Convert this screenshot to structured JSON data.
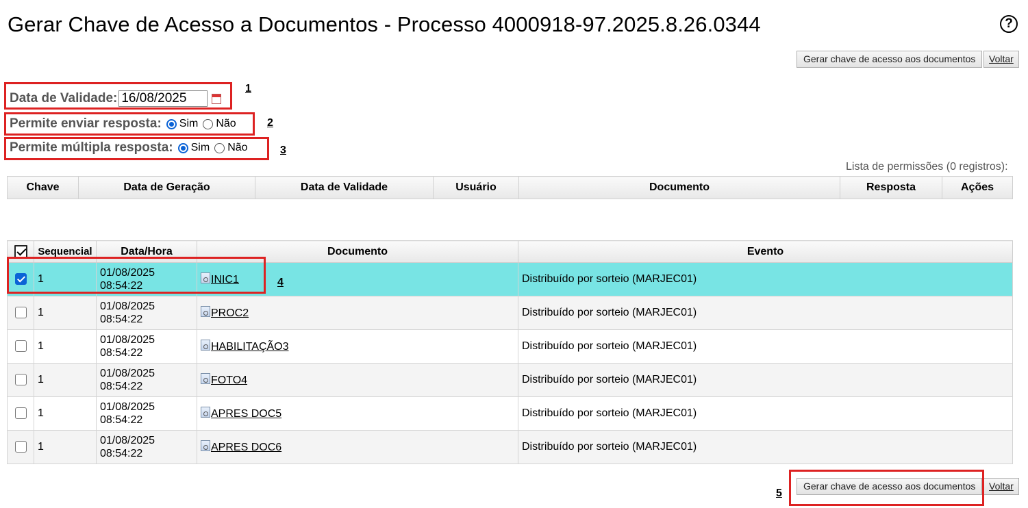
{
  "header": {
    "title": "Gerar Chave de Acesso a Documentos - Processo 4000918-97.2025.8.26.0344",
    "help_icon": "help-circle-icon"
  },
  "toolbar": {
    "generate_label": "Gerar chave de acesso aos documentos",
    "back_label": "Voltar"
  },
  "form": {
    "validity_label": "Data de Validade:",
    "validity_value": "16/08/2025",
    "calendar_icon": "calendar-icon",
    "allow_reply_label": "Permite enviar resposta:",
    "allow_multiple_label": "Permite múltipla resposta:",
    "yes_label": "Sim",
    "no_label": "Não",
    "allow_reply_value": "Sim",
    "allow_multiple_value": "Sim"
  },
  "markers": [
    "1",
    "2",
    "3",
    "4",
    "5"
  ],
  "permissions": {
    "caption": "Lista de permissões (0 registros):",
    "columns": [
      "Chave",
      "Data de Geração",
      "Data de Validade",
      "Usuário",
      "Documento",
      "Resposta",
      "Ações"
    ]
  },
  "documents": {
    "columns": [
      "Sequencial",
      "Data/Hora",
      "Documento",
      "Evento"
    ],
    "rows": [
      {
        "checked": true,
        "seq": "1",
        "date": "01/08/2025",
        "time": "08:54:22",
        "doc": "INIC1",
        "event": "Distribuído por sorteio (MARJEC01)"
      },
      {
        "checked": false,
        "seq": "1",
        "date": "01/08/2025",
        "time": "08:54:22",
        "doc": "PROC2",
        "event": "Distribuído por sorteio (MARJEC01)"
      },
      {
        "checked": false,
        "seq": "1",
        "date": "01/08/2025",
        "time": "08:54:22",
        "doc": "HABILITAÇÃO3",
        "event": "Distribuído por sorteio (MARJEC01)"
      },
      {
        "checked": false,
        "seq": "1",
        "date": "01/08/2025",
        "time": "08:54:22",
        "doc": "FOTO4",
        "event": "Distribuído por sorteio (MARJEC01)"
      },
      {
        "checked": false,
        "seq": "1",
        "date": "01/08/2025",
        "time": "08:54:22",
        "doc": "APRES DOC5",
        "event": "Distribuído por sorteio (MARJEC01)"
      },
      {
        "checked": false,
        "seq": "1",
        "date": "01/08/2025",
        "time": "08:54:22",
        "doc": "APRES DOC6",
        "event": "Distribuído por sorteio (MARJEC01)"
      }
    ]
  },
  "colors": {
    "highlight_row": "#78e4e4",
    "annotation_box": "#dd2222",
    "radio_accent": "#0b63d6"
  }
}
